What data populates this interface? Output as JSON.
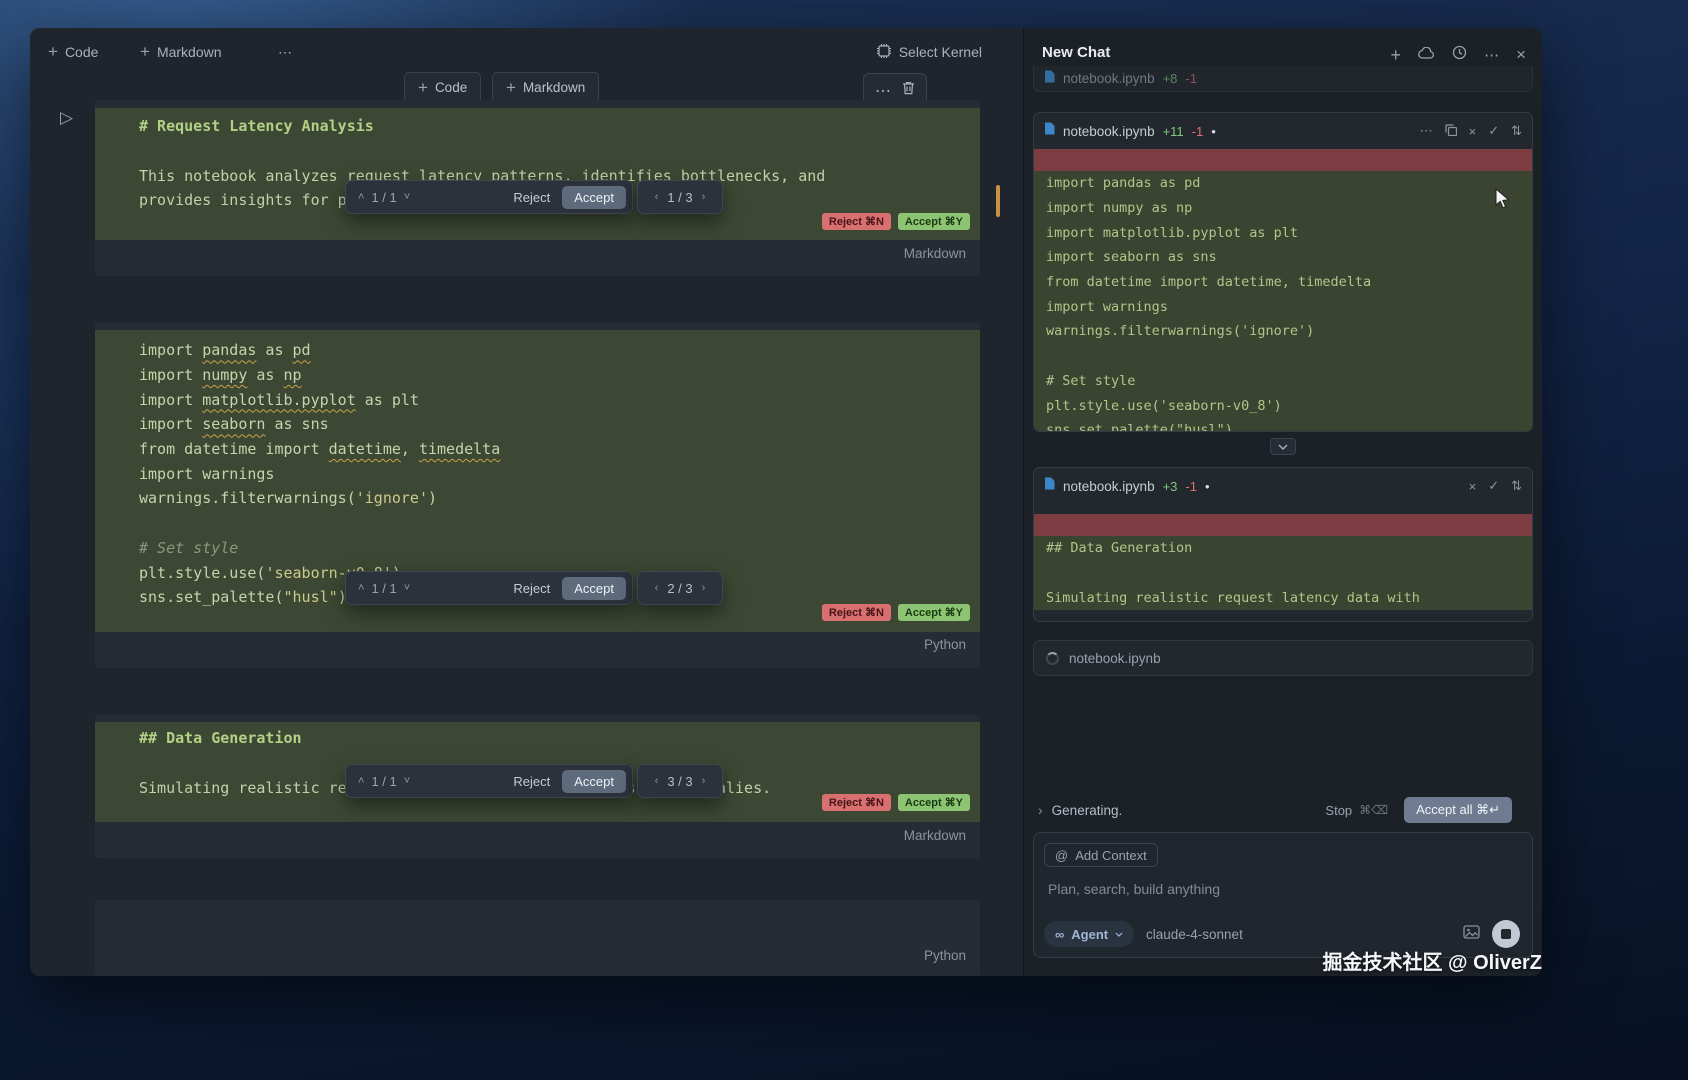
{
  "watermark": "掘金技术社区 @ OliverZ",
  "icons": {
    "chevron_up": "˄",
    "chevron_down": "˅",
    "nav_prev": "‹",
    "nav_next": "›",
    "more": "⋯",
    "close": "×",
    "plus": "+",
    "check": "✓",
    "expand": "⇅",
    "dirty_dot": "•",
    "at": "@",
    "infinity": "∞",
    "run": "▷",
    "generating_chevron": "›"
  },
  "notebook": {
    "toolbar": {
      "add_code": "Code",
      "add_markdown": "Markdown",
      "more": "⋯",
      "select_kernel": "Select Kernel"
    },
    "insert_bar": {
      "add_code": "Code",
      "add_markdown": "Markdown",
      "more": "⋯"
    },
    "cells": [
      {
        "kind": "markdown",
        "label": "Markdown",
        "lines": [
          [
            {
              "t": "# Request Latency Analysis",
              "c": "h"
            }
          ],
          [],
          [
            {
              "t": "This notebook analyzes request latency patterns, identifies bottlenecks, and",
              "c": "t"
            }
          ],
          [
            {
              "t": "provides insights for performance optimization.",
              "c": "t"
            }
          ]
        ],
        "badges": {
          "reject": "Reject ⌘N",
          "accept": "Accept ⌘Y"
        }
      },
      {
        "kind": "code",
        "label": "Python",
        "lines": [
          [
            {
              "t": "import ",
              "c": "c"
            },
            {
              "t": "pandas",
              "c": "u"
            },
            {
              "t": " as ",
              "c": "c"
            },
            {
              "t": "pd",
              "c": "u"
            }
          ],
          [
            {
              "t": "import ",
              "c": "c"
            },
            {
              "t": "numpy",
              "c": "u"
            },
            {
              "t": " as ",
              "c": "c"
            },
            {
              "t": "np",
              "c": "u"
            }
          ],
          [
            {
              "t": "import ",
              "c": "c"
            },
            {
              "t": "matplotlib.pyplot",
              "c": "u"
            },
            {
              "t": " as plt",
              "c": "c"
            }
          ],
          [
            {
              "t": "import ",
              "c": "c"
            },
            {
              "t": "seaborn",
              "c": "u"
            },
            {
              "t": " as sns",
              "c": "c"
            }
          ],
          [
            {
              "t": "from datetime import ",
              "c": "c"
            },
            {
              "t": "datetime",
              "c": "u"
            },
            {
              "t": ", ",
              "c": "c"
            },
            {
              "t": "timedelta",
              "c": "u"
            }
          ],
          [
            {
              "t": "import warnings",
              "c": "c"
            }
          ],
          [
            {
              "t": "warnings.filterwarnings(",
              "c": "c"
            },
            {
              "t": "'ignore'",
              "c": "s"
            },
            {
              "t": ")",
              "c": "c"
            }
          ],
          [],
          [
            {
              "t": "# Set style",
              "c": "cm"
            }
          ],
          [
            {
              "t": "plt.style.use(",
              "c": "c"
            },
            {
              "t": "'seaborn-v0_8'",
              "c": "s"
            },
            {
              "t": ")",
              "c": "c"
            }
          ],
          [
            {
              "t": "sns.set_palette(",
              "c": "c"
            },
            {
              "t": "\"husl\"",
              "c": "s"
            },
            {
              "t": ")",
              "c": "c"
            }
          ]
        ],
        "badges": {
          "reject": "Reject ⌘N",
          "accept": "Accept ⌘Y"
        }
      },
      {
        "kind": "markdown",
        "label": "Markdown",
        "lines": [
          [
            {
              "t": "## Data Generation",
              "c": "h"
            }
          ],
          [],
          [
            {
              "t": "Simulating realistic request latency data with patterns and anomalies.",
              "c": "t"
            }
          ]
        ],
        "badges": {
          "reject": "Reject ⌘N",
          "accept": "Accept ⌘Y"
        }
      },
      {
        "kind": "code",
        "label": "Python",
        "lines": []
      }
    ],
    "overlays": [
      {
        "counter": "1 / 1",
        "reject": "Reject",
        "accept": "Accept",
        "nav": "1 / 3"
      },
      {
        "counter": "1 / 1",
        "reject": "Reject",
        "accept": "Accept",
        "nav": "2 / 3"
      },
      {
        "counter": "1 / 1",
        "reject": "Reject",
        "accept": "Accept",
        "nav": "3 / 3"
      }
    ]
  },
  "chat": {
    "title": "New Chat",
    "partial_card": {
      "name": "notebook.ipynb",
      "added": "+8",
      "removed": "-1"
    },
    "cards": [
      {
        "name": "notebook.ipynb",
        "added": "+11",
        "removed": "-1",
        "dirty": "•",
        "icons": [
          "more",
          "copy",
          "close",
          "check",
          "expand"
        ],
        "rows": [
          {
            "type": "removed",
            "text": ""
          },
          {
            "type": "added",
            "text": "import pandas as pd"
          },
          {
            "type": "added",
            "text": "import numpy as np"
          },
          {
            "type": "added",
            "text": "import matplotlib.pyplot as plt"
          },
          {
            "type": "added",
            "text": "import seaborn as sns"
          },
          {
            "type": "added",
            "text": "from datetime import datetime, timedelta"
          },
          {
            "type": "added",
            "text": "import warnings"
          },
          {
            "type": "added",
            "text": "warnings.filterwarnings('ignore')"
          },
          {
            "type": "added",
            "text": ""
          },
          {
            "type": "added",
            "text": "# Set style"
          },
          {
            "type": "added",
            "text": "plt.style.use('seaborn-v0_8')"
          },
          {
            "type": "added",
            "text": "sns.set_palette(\"husl\")"
          }
        ]
      },
      {
        "name": "notebook.ipynb",
        "added": "+3",
        "removed": "-1",
        "dirty": "•",
        "icons": [
          "close",
          "check",
          "expand"
        ],
        "rows": [
          {
            "type": "removed",
            "text": ""
          },
          {
            "type": "added",
            "text": "## Data Generation"
          },
          {
            "type": "added",
            "text": ""
          },
          {
            "type": "added",
            "text": "Simulating realistic request latency data with"
          }
        ]
      }
    ],
    "loading_card": {
      "name": "notebook.ipynb"
    },
    "status": {
      "text": "Generating.",
      "stop": "Stop",
      "stop_keys": "⌘⌫",
      "accept_all": "Accept all ⌘↵"
    },
    "composer": {
      "context_chip": "Add Context",
      "placeholder": "Plan, search, build anything",
      "mode": "Agent",
      "model": "claude-4-sonnet"
    }
  }
}
